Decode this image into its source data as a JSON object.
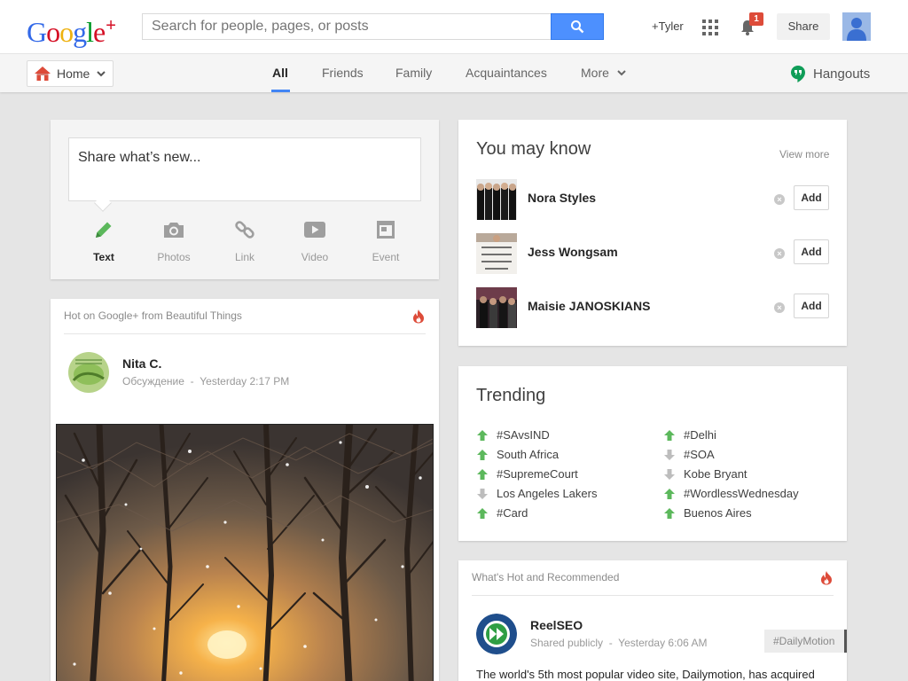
{
  "header": {
    "logo": {
      "g1": "G",
      "g2": "o",
      "g3": "o",
      "g4": "g",
      "g5": "l",
      "g6": "e",
      "plus": "+"
    },
    "search_placeholder": "Search for people, pages, or posts",
    "user_link": "+Tyler",
    "notification_count": "1",
    "share_label": "Share"
  },
  "nav": {
    "home_label": "Home",
    "tabs": [
      {
        "label": "All",
        "active": true
      },
      {
        "label": "Friends"
      },
      {
        "label": "Family"
      },
      {
        "label": "Acquaintances"
      },
      {
        "label": "More"
      }
    ],
    "hangouts_label": "Hangouts"
  },
  "sharebox": {
    "prompt": "Share what’s new...",
    "options": [
      {
        "label": "Text",
        "icon": "pencil-icon",
        "active": true
      },
      {
        "label": "Photos",
        "icon": "camera-icon"
      },
      {
        "label": "Link",
        "icon": "link-icon"
      },
      {
        "label": "Video",
        "icon": "video-icon"
      },
      {
        "label": "Event",
        "icon": "event-icon"
      }
    ]
  },
  "hot_post": {
    "heading": "Hot on Google+ from Beautiful Things",
    "author": "Nita C.",
    "meta": "Обсуждение  -  Yesterday 2:17 PM"
  },
  "you_may_know": {
    "title": "You may know",
    "view_more": "View more",
    "people": [
      {
        "name": "Nora Styles",
        "dismiss": "×",
        "add": "Add"
      },
      {
        "name": "Jess Wongsam",
        "dismiss": "×",
        "add": "Add"
      },
      {
        "name": "Maisie JANOSKIANS",
        "dismiss": "×",
        "add": "Add"
      }
    ]
  },
  "trending": {
    "title": "Trending",
    "left": [
      {
        "label": "#SAvsIND",
        "dir": "up"
      },
      {
        "label": "South Africa",
        "dir": "up"
      },
      {
        "label": "#SupremeCourt",
        "dir": "up"
      },
      {
        "label": "Los Angeles Lakers",
        "dir": "down"
      },
      {
        "label": "#Card",
        "dir": "up"
      }
    ],
    "right": [
      {
        "label": "#Delhi",
        "dir": "up"
      },
      {
        "label": "#SOA",
        "dir": "down"
      },
      {
        "label": "Kobe Bryant",
        "dir": "down"
      },
      {
        "label": "#WordlessWednesday",
        "dir": "up"
      },
      {
        "label": "Buenos Aires",
        "dir": "up"
      }
    ]
  },
  "whats_hot": {
    "heading": "What's Hot and Recommended",
    "author": "ReelSEO",
    "meta": "Shared publicly  -  Yesterday 6:06 AM",
    "tag": "#DailyMotion",
    "text": "The world's 5th most popular video site, Dailymotion, has acquired"
  },
  "colors": {
    "accent": "#4285f4",
    "trend_up": "#5cb85c",
    "trend_down": "#bdbdbd",
    "flame": "#dd4b39"
  }
}
